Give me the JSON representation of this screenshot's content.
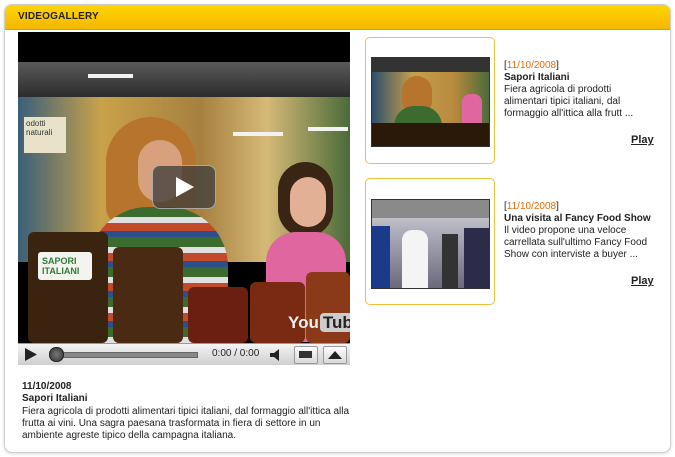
{
  "header": {
    "title": "VIDEOGALLERY"
  },
  "player": {
    "sign_text": "odotti\nnaturali",
    "jar_label": "SAPORI\nITALIANI",
    "logo_you": "You",
    "logo_tube": "Tube",
    "time_display": "0:00 / 0:00",
    "progress": 0
  },
  "main_video": {
    "date": "11/10/2008",
    "title": "Sapori Italiani",
    "description": "Fiera agricola di prodotti alimentari tipici italiani, dal formaggio all'ittica alla frutta ai vini.  Una sagra paesana trasformata in fiera di settore in un ambiente agreste tipico della campagna italiana."
  },
  "playlist": [
    {
      "bracket_open": "[",
      "date": "11/10/2008",
      "bracket_close": "]",
      "title": "Sapori Italiani",
      "description": "Fiera agricola di prodotti alimentari tipici italiani, dal formaggio all'ittica alla frutt ...",
      "play_label": "Play"
    },
    {
      "bracket_open": "[",
      "date": "11/10/2008",
      "bracket_close": "]",
      "title": "Una visita al Fancy Food Show",
      "description": "Il video propone una veloce carrellata sull'ultimo Fancy Food Show con interviste a buyer ...",
      "play_label": "Play"
    }
  ],
  "colors": {
    "header": "#ffd400",
    "accent_date": "#e06d0a",
    "card_border": "#f0c23c"
  }
}
